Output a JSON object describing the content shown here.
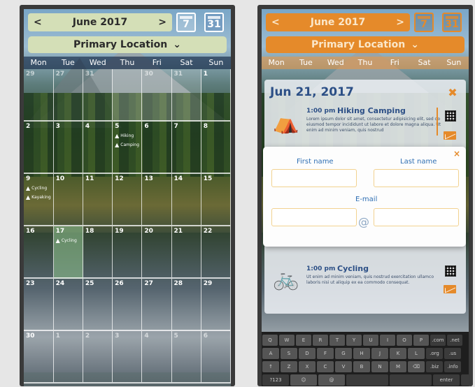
{
  "left": {
    "month_label": "June 2017",
    "prev_arrow": "<",
    "next_arrow": ">",
    "day_view_icon": "7",
    "month_view_icon": "31",
    "location_label": "Primary Location",
    "location_chevron": "⌄",
    "weekdays": [
      "Mon",
      "Tue",
      "Wed",
      "Thu",
      "Fri",
      "Sat",
      "Sun"
    ],
    "weeks": [
      [
        {
          "day": "29",
          "other": true
        },
        {
          "day": "27",
          "other": true
        },
        {
          "day": "31",
          "other": true
        },
        {
          "day": "",
          "other": true
        },
        {
          "day": "30",
          "other": true
        },
        {
          "day": "31",
          "other": true
        },
        {
          "day": "1"
        }
      ],
      [
        {
          "day": "2"
        },
        {
          "day": "3"
        },
        {
          "day": "4"
        },
        {
          "day": "5",
          "events": [
            "Hiking",
            "Camping"
          ]
        },
        {
          "day": "6"
        },
        {
          "day": "7"
        },
        {
          "day": "8"
        }
      ],
      [
        {
          "day": "9",
          "events": [
            "Cycling",
            "Kayaking"
          ]
        },
        {
          "day": "10"
        },
        {
          "day": "11"
        },
        {
          "day": "12"
        },
        {
          "day": "13"
        },
        {
          "day": "14"
        },
        {
          "day": "15"
        }
      ],
      [
        {
          "day": "16"
        },
        {
          "day": "17",
          "events": [
            "Cycling"
          ],
          "selected": true
        },
        {
          "day": "18"
        },
        {
          "day": "19"
        },
        {
          "day": "20"
        },
        {
          "day": "21"
        },
        {
          "day": "22"
        }
      ],
      [
        {
          "day": "23"
        },
        {
          "day": "24"
        },
        {
          "day": "25"
        },
        {
          "day": "26"
        },
        {
          "day": "27"
        },
        {
          "day": "28"
        },
        {
          "day": "29"
        }
      ],
      [
        {
          "day": "30"
        },
        {
          "day": "1",
          "other": true
        },
        {
          "day": "2",
          "other": true
        },
        {
          "day": "3",
          "other": true
        },
        {
          "day": "4",
          "other": true
        },
        {
          "day": "5",
          "other": true
        },
        {
          "day": "6",
          "other": true
        }
      ]
    ]
  },
  "right": {
    "month_label": "June 2017",
    "prev_arrow": "<",
    "next_arrow": ">",
    "day_view_icon": "7",
    "month_view_icon": "31",
    "location_label": "Primary Location",
    "location_chevron": "⌄",
    "weekdays": [
      "Mon",
      "Tue",
      "Wed",
      "Thu",
      "Fri",
      "Sat",
      "Sun"
    ],
    "day_title": "Jun 21, 2017",
    "event1": {
      "time": "1:00 pm",
      "name": "Hiking Camping",
      "description": "Lorem ipsum dolor sit amet, consectetur adipisicing elit, sed do eiusmod tempor incididunt ut labore et dolore magna aliqua. Ut enim ad minim veniam, quis nostrud"
    },
    "event2": {
      "time": "1:00 pm",
      "name": "Cycling",
      "description": "Ut enim ad minim veniam, quis nostrud exercitation ullamco laboris nisi ut aliquip ex ea commodo consequat."
    },
    "form": {
      "close_label": "×",
      "first_name_label": "First name",
      "last_name_label": "Last name",
      "email_label": "E-mail",
      "at_symbol": "@",
      "first_name_value": "",
      "last_name_value": "",
      "email_user_value": "",
      "email_domain_value": ""
    },
    "keyboard": {
      "row1": [
        "Q",
        "W",
        "E",
        "R",
        "T",
        "Y",
        "U",
        "I",
        "O",
        "P",
        ".com",
        ".net"
      ],
      "row2": [
        "A",
        "S",
        "D",
        "F",
        "G",
        "H",
        "J",
        "K",
        "L",
        ".org",
        ".us"
      ],
      "row3": [
        "↑",
        "Z",
        "X",
        "C",
        "V",
        "B",
        "N",
        "M",
        "⌫",
        ".biz",
        ".info"
      ],
      "row4": [
        "?123",
        "☺",
        "@",
        "",
        "",
        "enter",
        ".ca"
      ]
    }
  },
  "colors": {
    "accent_orange": "#e58a2a",
    "light_green_bar": "#d4dfb7",
    "title_blue": "#2c4f86"
  }
}
